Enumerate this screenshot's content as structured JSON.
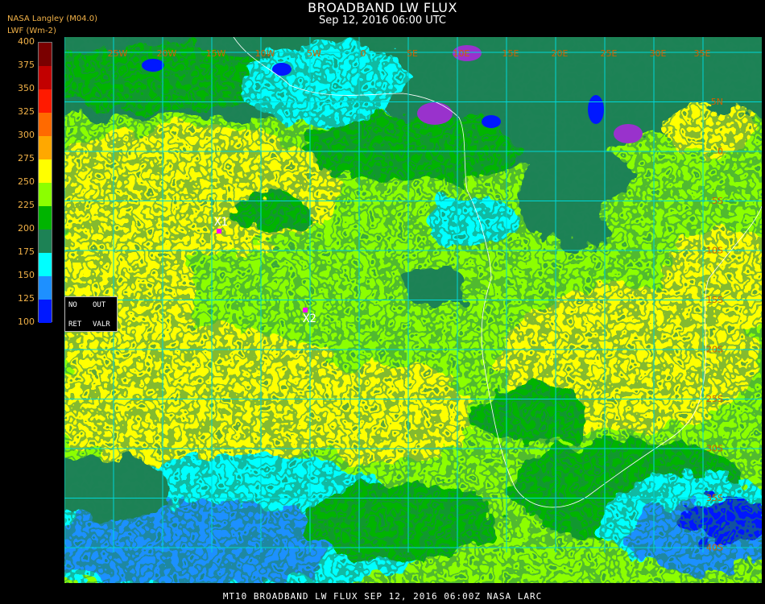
{
  "title": "BROADBAND LW FLUX",
  "subtitle": "Sep 12, 2016 06:00 UTC",
  "org": "NASA Langley (M04.0)",
  "unit_label": "LWF (Wm-2)",
  "legend": {
    "ticks": [
      "400",
      "375",
      "350",
      "325",
      "300",
      "275",
      "250",
      "225",
      "200",
      "175",
      "150",
      "125",
      "100"
    ],
    "colors": [
      "#7a0000",
      "#c20000",
      "#ff1a00",
      "#ff6a00",
      "#ffa800",
      "#ffff00",
      "#8cff00",
      "#00b400",
      "#1d8255",
      "#00ffff",
      "#1e90ff",
      "#0018ff",
      "#9932cc"
    ]
  },
  "lon_labels": [
    "25W",
    "20W",
    "15W",
    "10W",
    "5W",
    "0",
    "5E",
    "10E",
    "15E",
    "20E",
    "25E",
    "30E",
    "35E"
  ],
  "lat_labels": [
    "5N",
    "0",
    "5S",
    "10S",
    "15S",
    "20S",
    "25S",
    "30S",
    "35S",
    "40S"
  ],
  "markers": [
    {
      "label": "X1"
    },
    {
      "label": "X2"
    }
  ],
  "controls": {
    "no": "NO",
    "out": "OUT",
    "ret": "RET",
    "valr": "VALR"
  },
  "footer": "MT10  BROADBAND LW FLUX   SEP 12, 2016 06:00Z   NASA LARC",
  "colors": {
    "grid": "#00d7d7",
    "label": "#d06000",
    "marker": "#ff00ff",
    "coast": "#ffffff"
  }
}
